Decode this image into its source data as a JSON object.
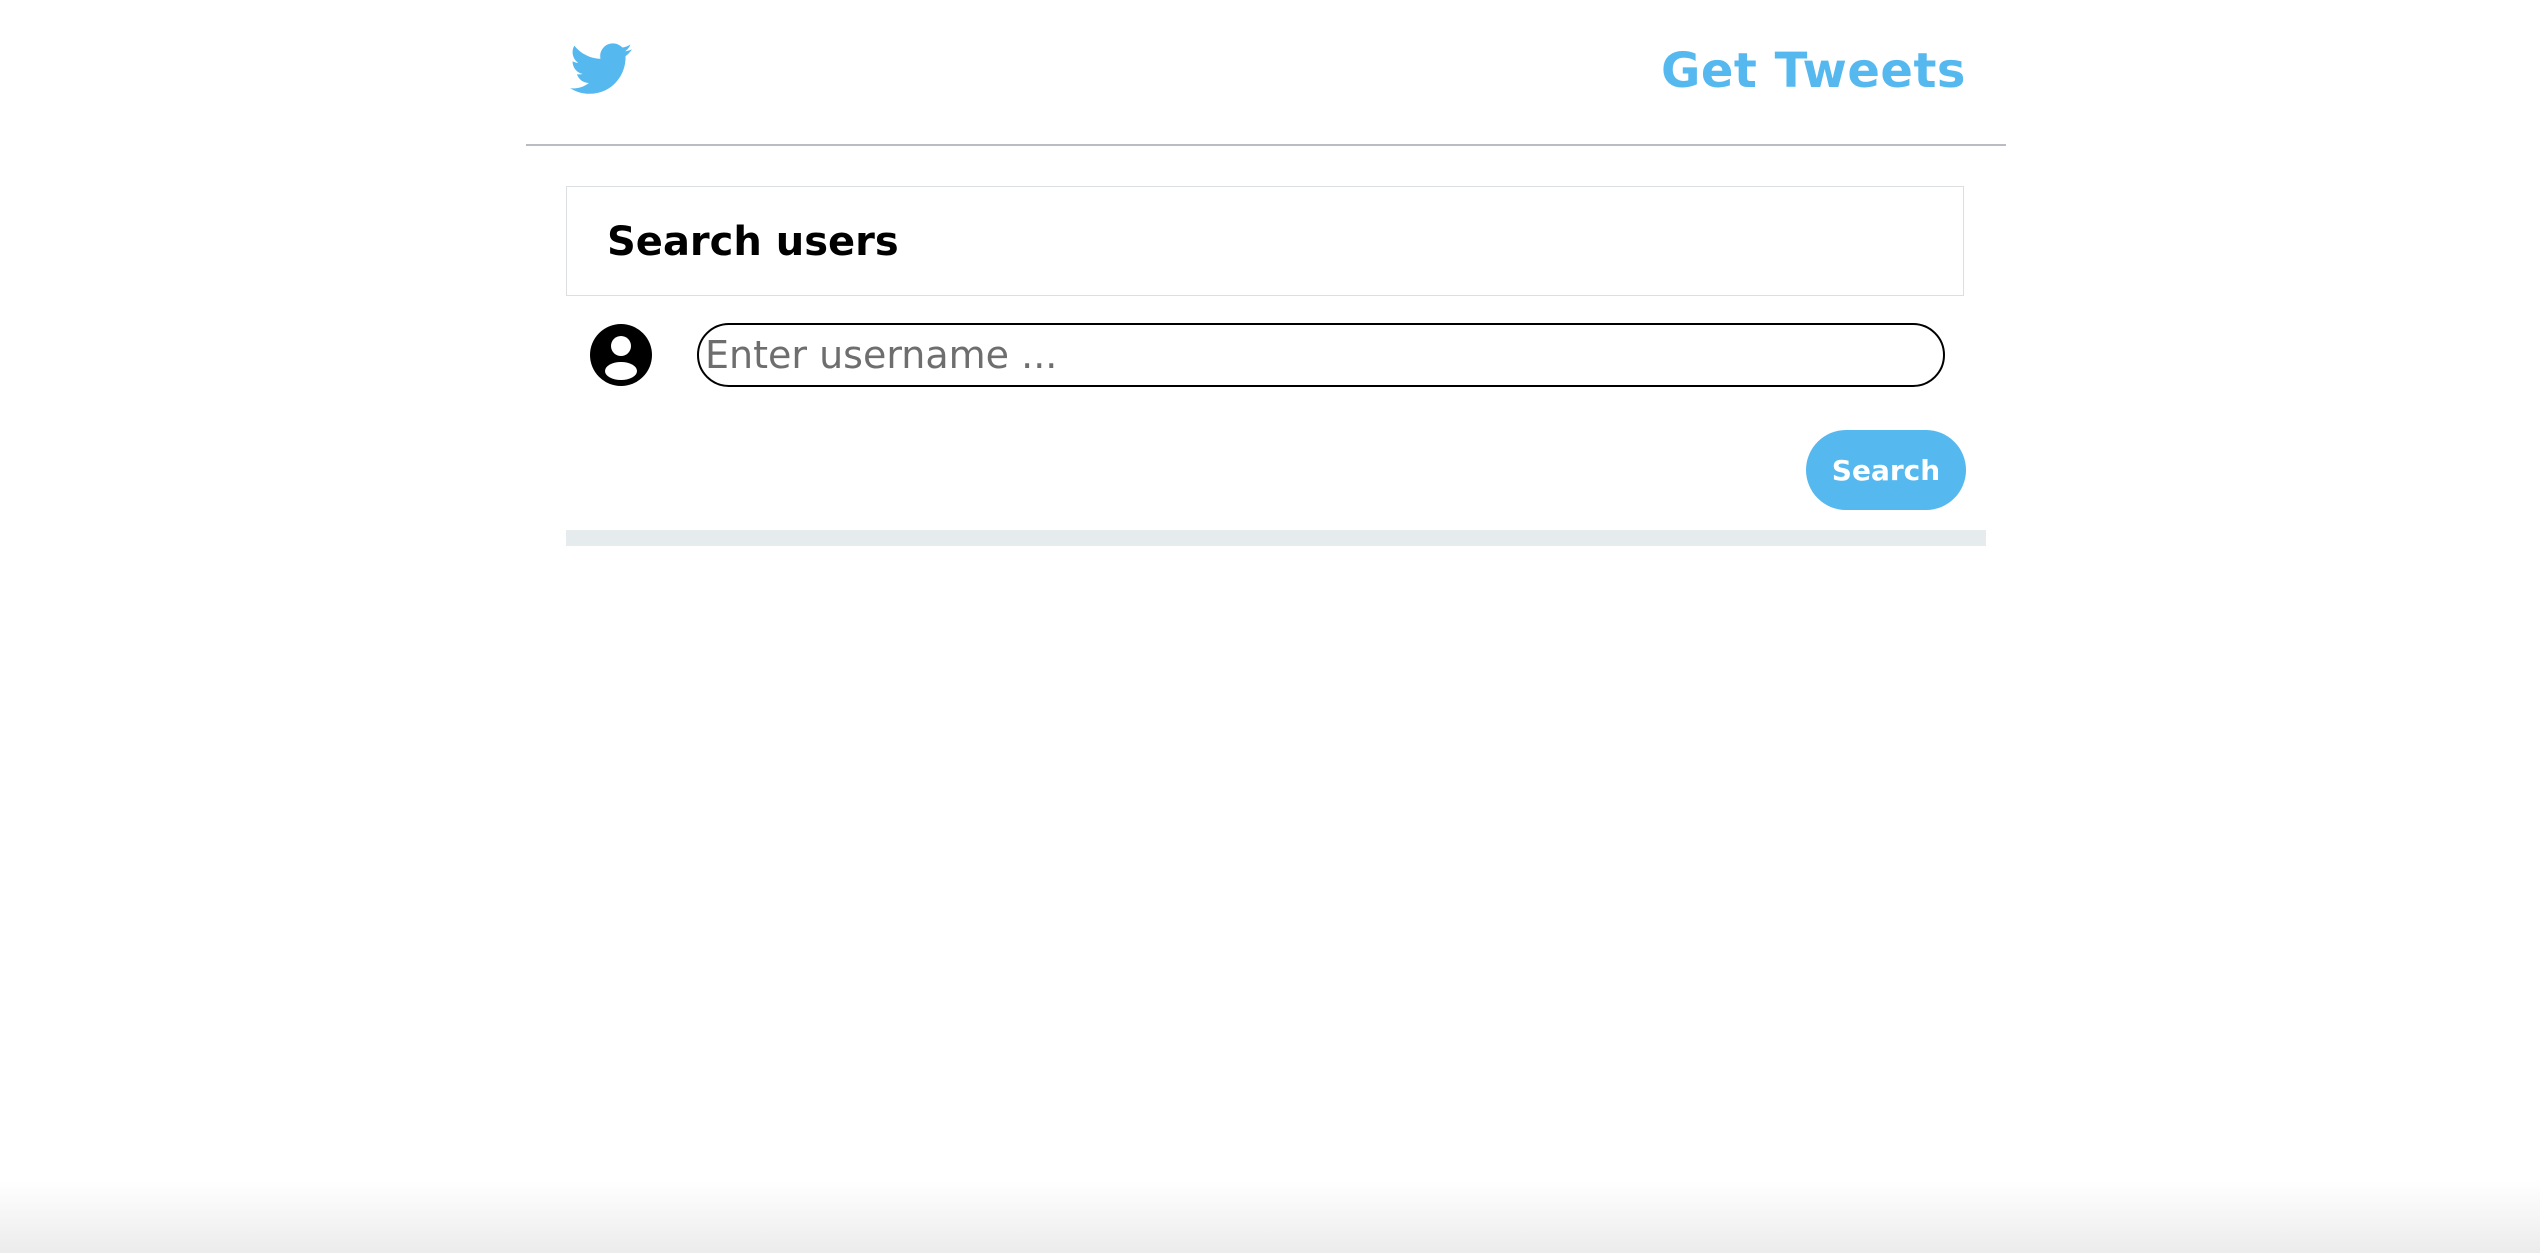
{
  "header": {
    "logo_icon": "twitter-bird-icon",
    "brand_label": "Get Tweets"
  },
  "search_card": {
    "title": "Search users"
  },
  "search_form": {
    "user_icon": "user-circle-icon",
    "input_placeholder": "Enter username ...",
    "input_value": "",
    "button_label": "Search"
  },
  "colors": {
    "accent": "#55b8ef",
    "divider": "#b9bdc2",
    "results_bar": "#e6ecee"
  }
}
